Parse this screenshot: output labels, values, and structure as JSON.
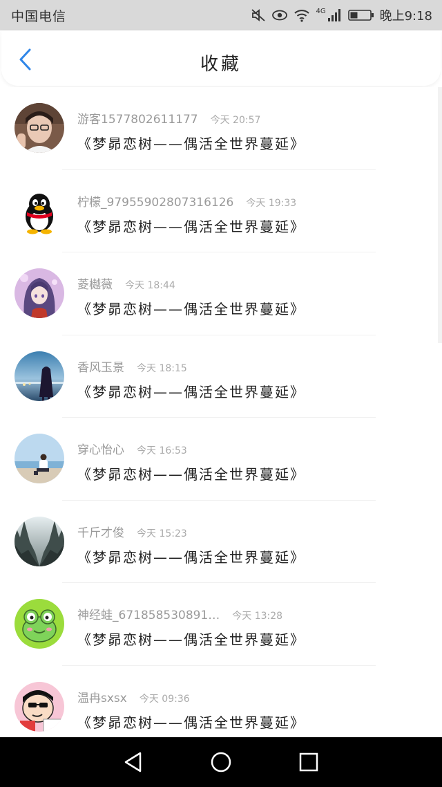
{
  "status_bar": {
    "carrier": "中国电信",
    "network": "4G",
    "time": "晚上9:18"
  },
  "header": {
    "title": "收藏"
  },
  "favorites": [
    {
      "username": "游客1577802611177",
      "time": "今天 20:57",
      "message": "《梦昴恋树——偶活全世界蔓延》",
      "avatar": "avatar-photo-woman-glasses"
    },
    {
      "username": "柠檬_97955902807316126",
      "time": "今天 19:33",
      "message": "《梦昴恋树——偶活全世界蔓延》",
      "avatar": "avatar-qq-penguin"
    },
    {
      "username": "菱樾薇",
      "time": "今天 18:44",
      "message": "《梦昴恋树——偶活全世界蔓延》",
      "avatar": "avatar-anime-girl-purple"
    },
    {
      "username": "香风玉景",
      "time": "今天 18:15",
      "message": "《梦昴恋树——偶活全世界蔓延》",
      "avatar": "avatar-girl-silhouette-dusk"
    },
    {
      "username": "穿心怡心",
      "time": "今天 16:53",
      "message": "《梦昴恋树——偶活全世界蔓延》",
      "avatar": "avatar-beach-person"
    },
    {
      "username": "千斤才俊",
      "time": "今天 15:23",
      "message": "《梦昴恋树——偶活全世界蔓延》",
      "avatar": "avatar-misty-forest"
    },
    {
      "username": "神经蛙_671858530891…",
      "time": "今天 13:28",
      "message": "《梦昴恋树——偶活全世界蔓延》",
      "avatar": "avatar-green-frog"
    },
    {
      "username": "温冉sxsx",
      "time": "今天 09:36",
      "message": "《梦昴恋树——偶活全世界蔓延》",
      "avatar": "avatar-crayon-shinchan"
    }
  ],
  "colors": {
    "accent": "#2f86e8",
    "status_bar_bg": "#d9d9d9",
    "nav_bar_bg": "#000000"
  }
}
